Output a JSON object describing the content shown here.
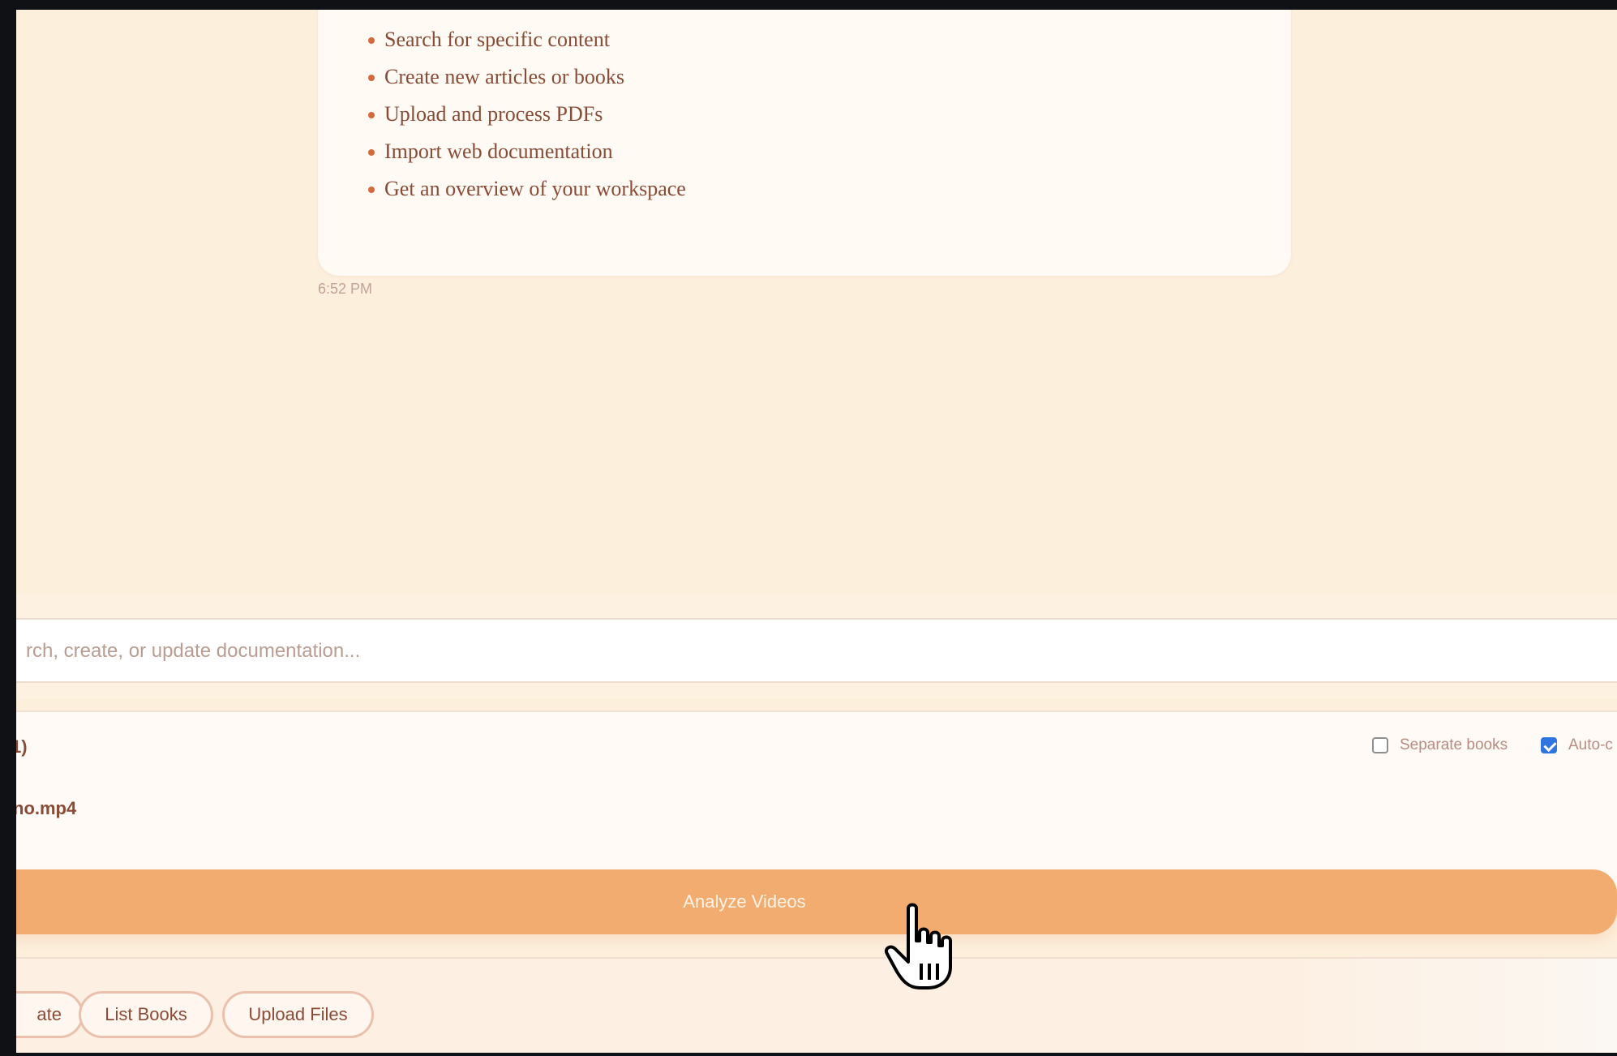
{
  "chat": {
    "capabilities": [
      "Search for specific content",
      "Create new articles or books",
      "Upload and process PDFs",
      "Import web documentation",
      "Get an overview of your workspace"
    ],
    "timestamp": "6:52 PM"
  },
  "composer": {
    "placeholder": "rch, create, or update documentation..."
  },
  "upload": {
    "files_count_label": "1)",
    "file_name": "no.mp4",
    "separate_books_label": "Separate books",
    "separate_books_checked": false,
    "auto_label": "Auto-c",
    "auto_checked": true,
    "analyze_label": "Analyze Videos"
  },
  "quick_actions": [
    {
      "label": "ate"
    },
    {
      "label": "List Books"
    },
    {
      "label": "Upload Files"
    }
  ],
  "colors": {
    "background": "#fcefdc",
    "accent": "#f3ac70",
    "text": "#8a4b36",
    "checkbox_checked": "#2f74e0"
  }
}
